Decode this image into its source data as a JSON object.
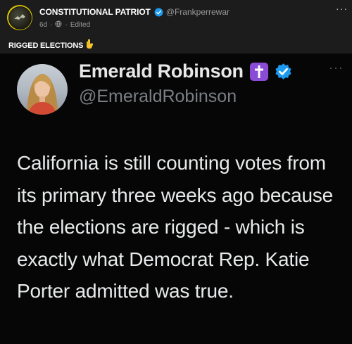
{
  "post": {
    "author_name": "CONSTITUTIONAL PATRIOT",
    "author_handle": "@Frankperrewar",
    "age": "6d",
    "separator": "·",
    "edited_label": "Edited",
    "caption": "RIGGED ELECTIONS",
    "more_label": "···",
    "colors": {
      "background": "#1c1c1c",
      "avatar_ring": "#d9c400",
      "verified": "#1d9bf0"
    }
  },
  "tweet": {
    "display_name": "Emerald Robinson",
    "handle": "@EmeraldRobinson",
    "more_label": "···",
    "body": "California is still counting votes from its primary three weeks ago because the elections are rigged - which is exactly what Democrat Rep. Katie Porter admitted was true.",
    "colors": {
      "background": "#060606",
      "cross_badge": "#8a4bd6",
      "verified": "#1d9bf0"
    }
  },
  "icons": [
    "avatar-icon",
    "verified-badge-icon",
    "globe-icon",
    "pointing-down-hand-icon",
    "cross-badge-icon",
    "more-options-icon"
  ]
}
